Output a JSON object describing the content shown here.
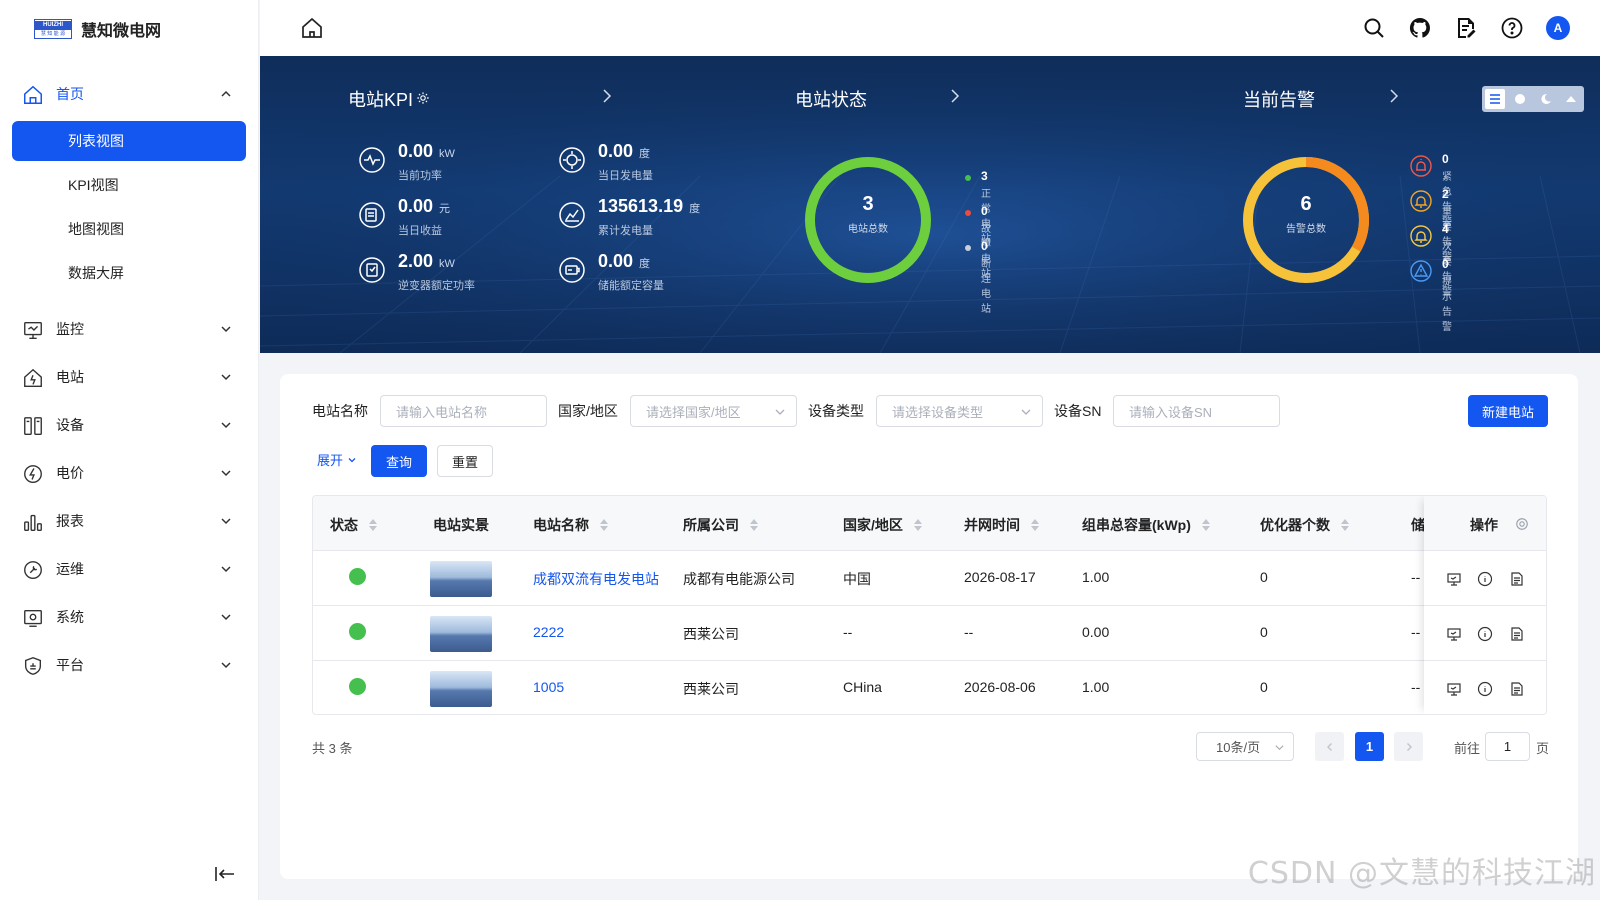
{
  "app": {
    "name": "慧知微电网",
    "logo_top": "HUIZHI",
    "logo_bottom": "慧 知 能 源"
  },
  "sidebar": {
    "home": {
      "label": "首页"
    },
    "sub_items": [
      {
        "label": "列表视图",
        "active": true
      },
      {
        "label": "KPI视图"
      },
      {
        "label": "地图视图"
      },
      {
        "label": "数据大屏"
      }
    ],
    "items": [
      {
        "label": "监控",
        "icon": "monitor-icon"
      },
      {
        "label": "电站",
        "icon": "station-icon"
      },
      {
        "label": "设备",
        "icon": "device-icon"
      },
      {
        "label": "电价",
        "icon": "price-icon"
      },
      {
        "label": "报表",
        "icon": "report-icon"
      },
      {
        "label": "运维",
        "icon": "maintenance-icon"
      },
      {
        "label": "系统",
        "icon": "system-icon"
      },
      {
        "label": "平台",
        "icon": "platform-icon"
      }
    ]
  },
  "header": {
    "avatar_letter": "A"
  },
  "dashboard": {
    "kpi_title": "电站KPI",
    "kpis": [
      {
        "value": "0.00",
        "unit": "kW",
        "label": "当前功率"
      },
      {
        "value": "0.00",
        "unit": "度",
        "label": "当日发电量"
      },
      {
        "value": "0.00",
        "unit": "元",
        "label": "当日收益"
      },
      {
        "value": "135613.19",
        "unit": "度",
        "label": "累计发电量"
      },
      {
        "value": "2.00",
        "unit": "kW",
        "label": "逆变器额定功率"
      },
      {
        "value": "0.00",
        "unit": "度",
        "label": "储能额定容量"
      }
    ],
    "status_title": "电站状态",
    "status_total": {
      "value": "3",
      "label": "电站总数"
    },
    "status_legend": [
      {
        "value": "3",
        "label": "正常电站",
        "color": "#45c04f"
      },
      {
        "value": "0",
        "label": "故障电站",
        "color": "#ee4b3b"
      },
      {
        "value": "0",
        "label": "断连电站",
        "color": "#c8d0dc"
      }
    ],
    "alarm_title": "当前告警",
    "alarm_total": {
      "value": "6",
      "label": "告警总数"
    },
    "alarms": [
      {
        "value": "0",
        "label": "紧急告警",
        "color": "#f0584a"
      },
      {
        "value": "2",
        "label": "重要告警",
        "color": "#f5a623"
      },
      {
        "value": "4",
        "label": "次要告警",
        "color": "#f7c843"
      },
      {
        "value": "0",
        "label": "提示告警",
        "color": "#4a9bf5"
      }
    ]
  },
  "filters": {
    "station_name": {
      "label": "电站名称",
      "placeholder": "请输入电站名称"
    },
    "country": {
      "label": "国家/地区",
      "placeholder": "请选择国家/地区"
    },
    "device_type": {
      "label": "设备类型",
      "placeholder": "请选择设备类型"
    },
    "device_sn": {
      "label": "设备SN",
      "placeholder": "请输入设备SN"
    },
    "new_button": "新建电站",
    "expand": "展开",
    "query": "查询",
    "reset": "重置"
  },
  "table": {
    "columns": [
      "状态",
      "电站实景",
      "电站名称",
      "所属公司",
      "国家/地区",
      "并网时间",
      "组串总容量(kWp)",
      "优化器个数",
      "储",
      "操作"
    ],
    "rows": [
      {
        "name": "成都双流有电发电站",
        "company": "成都有电能源公司",
        "country": "中国",
        "grid_time": "2026-08-17",
        "capacity": "1.00",
        "optimizers": "0",
        "storage": "--"
      },
      {
        "name": "2222",
        "company": "西莱公司",
        "country": "--",
        "grid_time": "--",
        "capacity": "0.00",
        "optimizers": "0",
        "storage": "--"
      },
      {
        "name": "1005",
        "company": "西莱公司",
        "country": "CHina",
        "grid_time": "2026-08-06",
        "capacity": "1.00",
        "optimizers": "0",
        "storage": "--"
      }
    ]
  },
  "pagination": {
    "total": "共 3 条",
    "page_size": "10条/页",
    "current_page": "1",
    "goto_label": "前往",
    "goto_value": "1",
    "page_suffix": "页"
  },
  "watermark": "CSDN @文慧的科技江湖"
}
